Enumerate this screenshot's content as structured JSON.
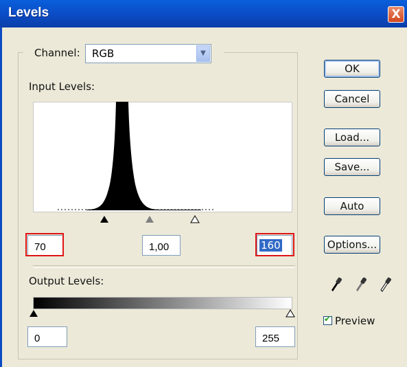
{
  "window": {
    "title": "Levels",
    "close_label": "X"
  },
  "channel": {
    "label": "Channel:",
    "value": "RGB"
  },
  "input_levels": {
    "label": "Input Levels:",
    "shadow": "70",
    "midtone": "1,00",
    "highlight": "160"
  },
  "output_levels": {
    "label": "Output Levels:",
    "min": "0",
    "max": "255"
  },
  "buttons": {
    "ok": "OK",
    "cancel": "Cancel",
    "load": "Load...",
    "save": "Save...",
    "auto": "Auto",
    "options": "Options..."
  },
  "preview": {
    "label": "Preview",
    "checked": true
  },
  "colors": {
    "title_bar": "#0b4bc4",
    "dialog_bg": "#ece9d8",
    "highlight_box": "#e01414",
    "selected_text_bg": "#316ac5"
  },
  "icons": [
    "black-eyedropper-icon",
    "gray-eyedropper-icon",
    "white-eyedropper-icon"
  ]
}
